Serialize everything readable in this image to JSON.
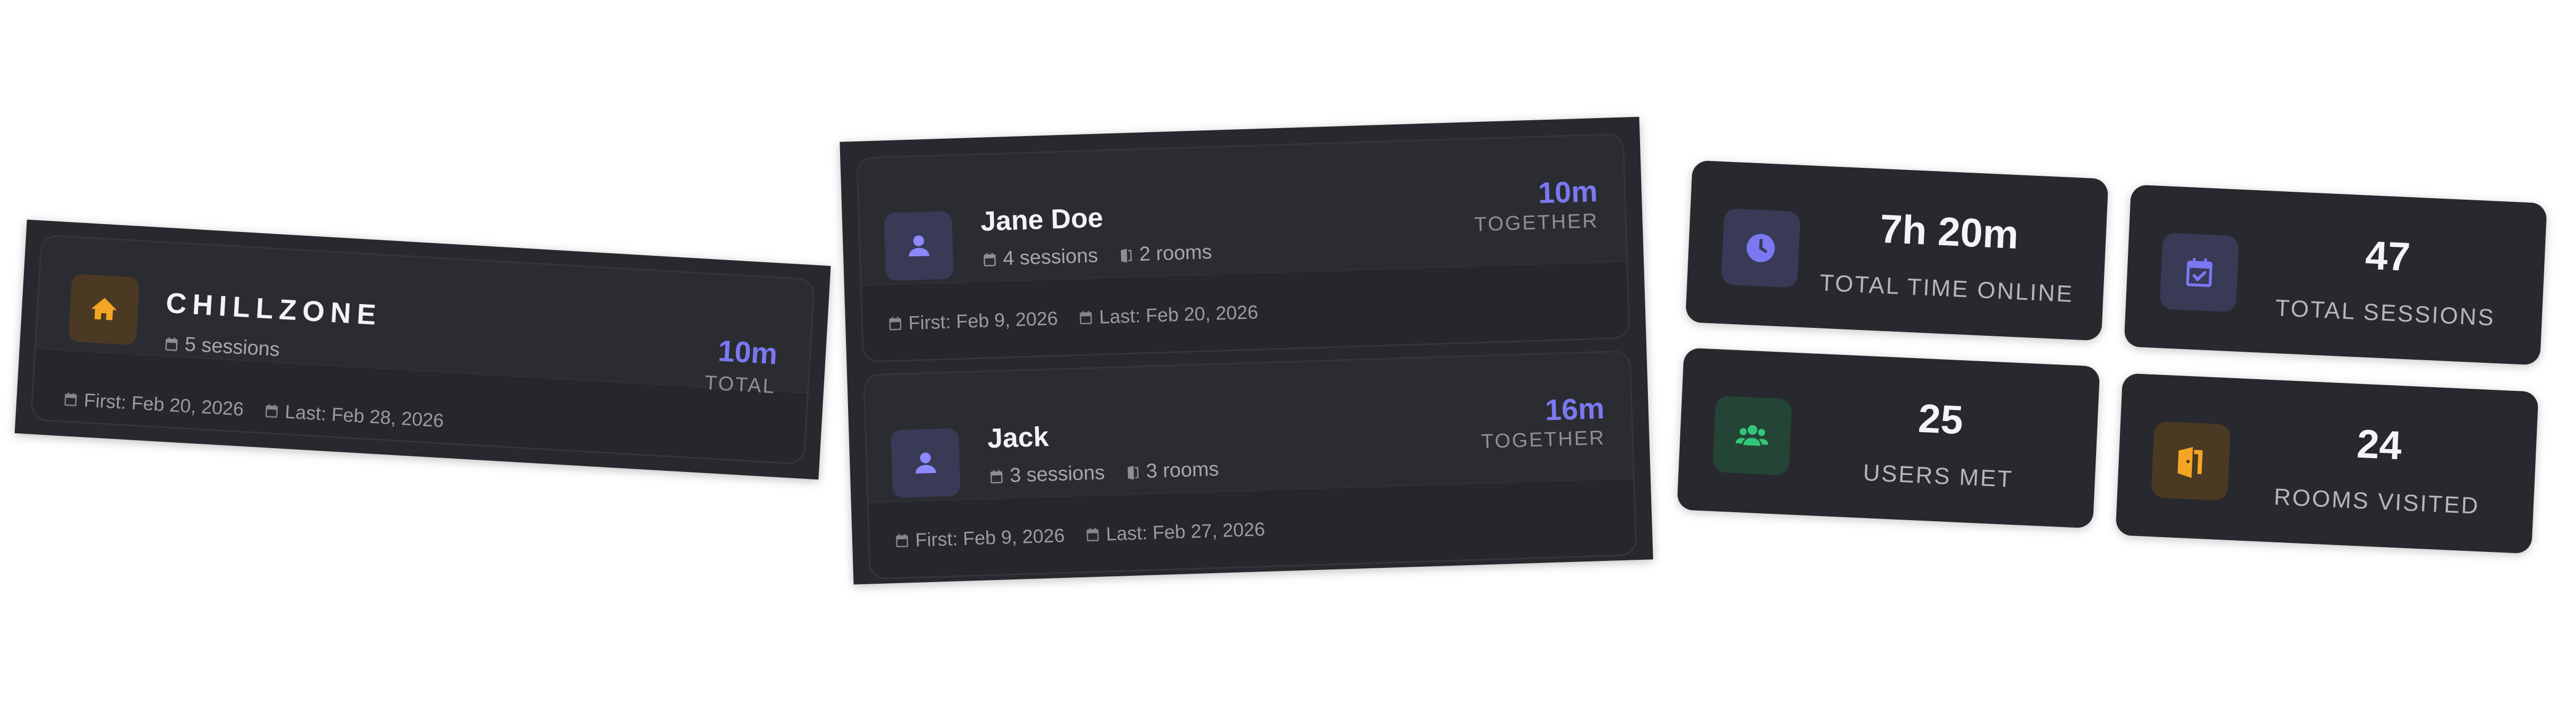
{
  "colors": {
    "accent": "#7b78f2",
    "home_icon": "#f5a524",
    "users_icon": "#34c77b",
    "door_icon": "#f5a524",
    "card_bg": "#28292e"
  },
  "room": {
    "icon": "home-icon",
    "name": "CHILLZONE",
    "sessions": "5 sessions",
    "first": "First: Feb 20, 2026",
    "last": "Last: Feb 28, 2026",
    "time": "10m",
    "time_caption": "TOTAL"
  },
  "users": [
    {
      "icon": "user-icon",
      "name": "Jane Doe",
      "sessions": "4 sessions",
      "rooms": "2 rooms",
      "first": "First: Feb 9, 2026",
      "last": "Last: Feb 20, 2026",
      "time": "10m",
      "time_caption": "TOGETHER"
    },
    {
      "icon": "user-icon",
      "name": "Jack",
      "sessions": "3 sessions",
      "rooms": "3 rooms",
      "first": "First: Feb 9, 2026",
      "last": "Last: Feb 27, 2026",
      "time": "16m",
      "time_caption": "TOGETHER"
    }
  ],
  "stats": [
    {
      "icon": "clock-icon",
      "value": "7h 20m",
      "label": "TOTAL TIME ONLINE"
    },
    {
      "icon": "calendar-check-icon",
      "value": "47",
      "label": "TOTAL SESSIONS"
    },
    {
      "icon": "users-group-icon",
      "value": "25",
      "label": "USERS MET"
    },
    {
      "icon": "door-open-icon",
      "value": "24",
      "label": "ROOMS VISITED"
    }
  ]
}
